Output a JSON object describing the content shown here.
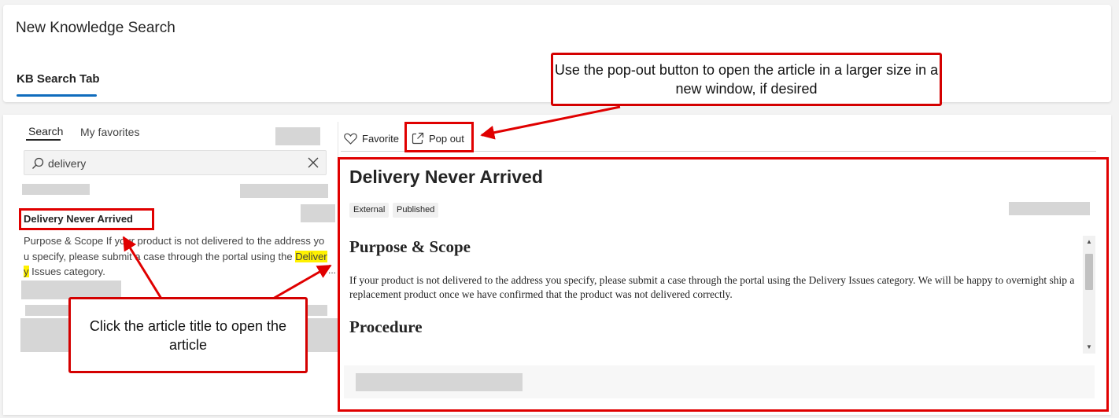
{
  "header": {
    "title": "New Knowledge Search",
    "tab_label": "KB Search Tab"
  },
  "left_panel": {
    "tabs": [
      "Search",
      "My favorites"
    ],
    "active_tab": "Search",
    "search": {
      "value": "delivery",
      "icon": "search-icon",
      "clear_icon": "close-icon"
    },
    "result": {
      "title": "Delivery Never Arrived",
      "snippet_before": "Purpose & Scope If your product is not delivered to the address you specify, please submit a case through the portal using the ",
      "snippet_highlight": "Delivery",
      "snippet_after": " Issues category.",
      "more": "..."
    }
  },
  "toolbar": {
    "favorite_label": "Favorite",
    "popout_label": "Pop out"
  },
  "article": {
    "title": "Delivery Never Arrived",
    "tags": [
      "External",
      "Published"
    ],
    "heading1": "Purpose & Scope",
    "paragraph1": "If your product is not delivered to the address you specify, please submit a case through the portal using the Delivery Issues category. We will be happy to overnight ship a replacement product once we have confirmed that the product was not delivered correctly.",
    "heading2": "Procedure"
  },
  "annotations": {
    "popout_callout": "Use the pop-out button to open the article in a larger size in a new window, if desired",
    "title_callout": "Click the article title to open the article"
  },
  "colors": {
    "accent": "#0f6cbd",
    "annotation_red": "#e00000",
    "highlight": "#fff100"
  }
}
